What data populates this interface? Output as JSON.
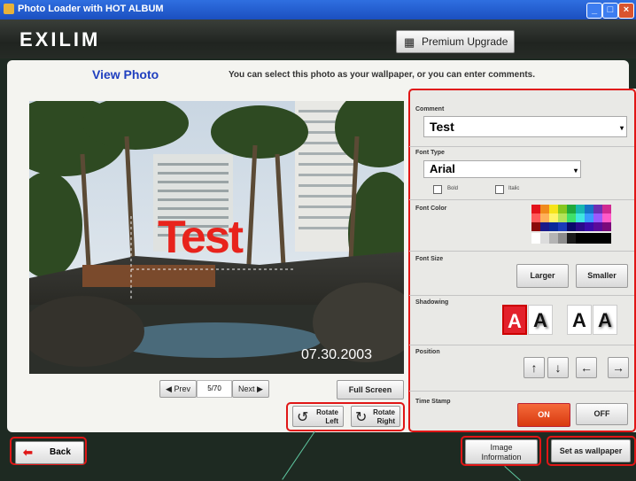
{
  "window": {
    "title": "Photo Loader with HOT ALBUM",
    "controls": [
      "minimize",
      "maximize",
      "close"
    ]
  },
  "header": {
    "logo": "EXILIM",
    "upgrade_label": "Premium Upgrade",
    "upgrade_icon": "premium-icon"
  },
  "view": {
    "title": "View Photo",
    "hint": "You can select this photo as your wallpaper, or you can enter comments."
  },
  "photo": {
    "overlay_text": "Test",
    "date_stamp": "07.30.2003",
    "overlay_color": "#e8231c"
  },
  "navigation": {
    "prev_label": "Prev",
    "page_indicator": "5/70",
    "next_label": "Next",
    "fullscreen_label": "Full Screen",
    "rotate_left_label": [
      "Rotate",
      "Left"
    ],
    "rotate_right_label": [
      "Rotate",
      "Right"
    ]
  },
  "settings": {
    "comment": {
      "label": "Comment",
      "value": "Test"
    },
    "font_type": {
      "label": "Font Type",
      "value": "Arial",
      "bold_label": "Bold",
      "italic_label": "Italic"
    },
    "font_color": {
      "label": "Font Color"
    },
    "font_size": {
      "label": "Font Size",
      "larger_label": "Larger",
      "smaller_label": "Smaller"
    },
    "shadowing": {
      "label": "Shadowing"
    },
    "position": {
      "label": "Position"
    },
    "time_stamp": {
      "label": "Time Stamp",
      "on_label": "ON",
      "off_label": "OFF",
      "selected": "ON"
    }
  },
  "bottom": {
    "back_label": "Back",
    "image_info_label": [
      "Image",
      "Information"
    ],
    "wallpaper_label": "Set as wallpaper"
  },
  "colors": {
    "accent_title": "#1f3fbf",
    "highlight_box": "#e01616",
    "on_button": "#e8502a"
  }
}
